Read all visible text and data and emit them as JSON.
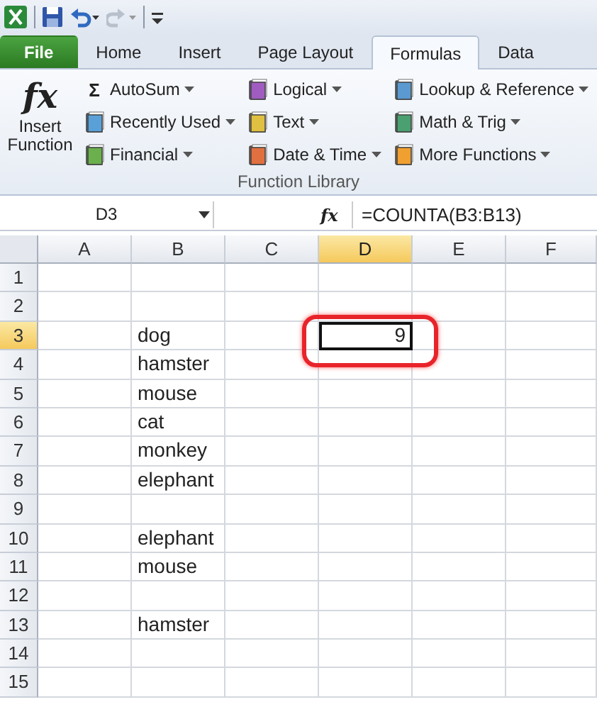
{
  "tabs": [
    {
      "label": "File",
      "kind": "file",
      "selected": false
    },
    {
      "label": "Home",
      "kind": "tab",
      "selected": false
    },
    {
      "label": "Insert",
      "kind": "tab",
      "selected": false
    },
    {
      "label": "Page Layout",
      "kind": "tab",
      "selected": false
    },
    {
      "label": "Formulas",
      "kind": "tab",
      "selected": true
    },
    {
      "label": "Data",
      "kind": "tab",
      "selected": false
    }
  ],
  "ribbon": {
    "insert_function": {
      "icon": "fx",
      "label": "Insert Function"
    },
    "columns": [
      [
        {
          "label": "AutoSum",
          "kind": "sigma",
          "icon": "Σ"
        },
        {
          "label": "Recently Used",
          "kind": "book"
        },
        {
          "label": "Financial",
          "kind": "book"
        }
      ],
      [
        {
          "label": "Logical",
          "kind": "book"
        },
        {
          "label": "Text",
          "kind": "book"
        },
        {
          "label": "Date & Time",
          "kind": "book"
        }
      ],
      [
        {
          "label": "Lookup & Reference",
          "kind": "book"
        },
        {
          "label": "Math & Trig",
          "kind": "book"
        },
        {
          "label": "More Functions",
          "kind": "book"
        }
      ]
    ],
    "group_label": "Function Library"
  },
  "formula_bar": {
    "name_box": "D3",
    "fx": "fx",
    "formula": "=COUNTA(B3:B13)"
  },
  "columns": [
    {
      "label": "A",
      "selected": false
    },
    {
      "label": "B",
      "selected": false
    },
    {
      "label": "C",
      "selected": false
    },
    {
      "label": "D",
      "selected": true
    },
    {
      "label": "E",
      "selected": false
    },
    {
      "label": "F",
      "selected": false
    }
  ],
  "rows": [
    {
      "number": "1",
      "selected": false,
      "cells": [
        null,
        null,
        null,
        null,
        null,
        null
      ]
    },
    {
      "number": "2",
      "selected": false,
      "cells": [
        null,
        null,
        null,
        null,
        null,
        null
      ]
    },
    {
      "number": "3",
      "selected": true,
      "cells": [
        null,
        {
          "value": "dog",
          "kind": "text",
          "selected": false
        },
        null,
        {
          "value": "9",
          "kind": "number",
          "selected": true,
          "circled": true
        },
        null,
        null
      ]
    },
    {
      "number": "4",
      "selected": false,
      "cells": [
        null,
        {
          "value": "hamster",
          "kind": "text",
          "selected": false
        },
        null,
        null,
        null,
        null
      ]
    },
    {
      "number": "5",
      "selected": false,
      "cells": [
        null,
        {
          "value": "mouse",
          "kind": "text",
          "selected": false
        },
        null,
        null,
        null,
        null
      ]
    },
    {
      "number": "6",
      "selected": false,
      "cells": [
        null,
        {
          "value": "cat",
          "kind": "text",
          "selected": false
        },
        null,
        null,
        null,
        null
      ]
    },
    {
      "number": "7",
      "selected": false,
      "cells": [
        null,
        {
          "value": "monkey",
          "kind": "text",
          "selected": false
        },
        null,
        null,
        null,
        null
      ]
    },
    {
      "number": "8",
      "selected": false,
      "cells": [
        null,
        {
          "value": "elephant",
          "kind": "text",
          "selected": false
        },
        null,
        null,
        null,
        null
      ]
    },
    {
      "number": "9",
      "selected": false,
      "cells": [
        null,
        null,
        null,
        null,
        null,
        null
      ]
    },
    {
      "number": "10",
      "selected": false,
      "cells": [
        null,
        {
          "value": "elephant",
          "kind": "text",
          "selected": false
        },
        null,
        null,
        null,
        null
      ]
    },
    {
      "number": "11",
      "selected": false,
      "cells": [
        null,
        {
          "value": "mouse",
          "kind": "text",
          "selected": false
        },
        null,
        null,
        null,
        null
      ]
    },
    {
      "number": "12",
      "selected": false,
      "cells": [
        null,
        null,
        null,
        null,
        null,
        null
      ]
    },
    {
      "number": "13",
      "selected": false,
      "cells": [
        null,
        {
          "value": "hamster",
          "kind": "text",
          "selected": false
        },
        null,
        null,
        null,
        null
      ]
    },
    {
      "number": "14",
      "selected": false,
      "cells": [
        null,
        null,
        null,
        null,
        null,
        null
      ]
    },
    {
      "number": "15",
      "selected": false,
      "cells": [
        null,
        null,
        null,
        null,
        null,
        null
      ]
    }
  ]
}
